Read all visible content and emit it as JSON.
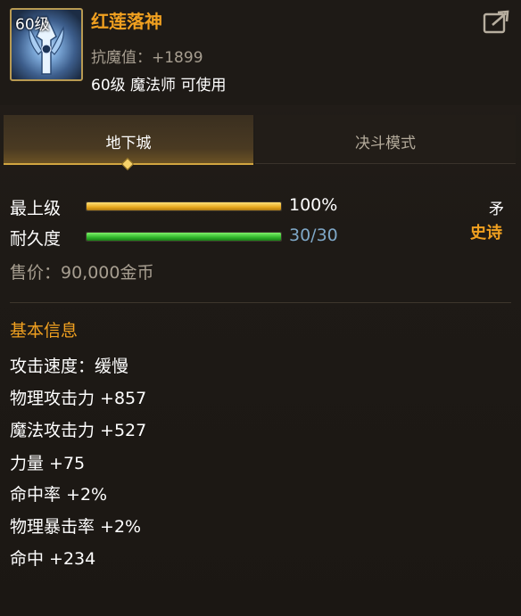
{
  "item": {
    "level_badge": "60级",
    "name": "红莲落神",
    "stat_line": "抗魔值：+1899",
    "requirement": "60级 魔法师 可使用",
    "share_icon": "share-icon"
  },
  "tabs": [
    {
      "label": "地下城",
      "active": true
    },
    {
      "label": "决斗模式",
      "active": false
    }
  ],
  "status": {
    "grade": {
      "label": "最上级",
      "value_text": "100%",
      "value": 1.0
    },
    "durability": {
      "label": "耐久度",
      "value_text": "30/30",
      "value": 1.0
    },
    "weapon_type": "矛",
    "rarity": "史诗",
    "price": "售价：90,000金币"
  },
  "basic_info": {
    "title": "基本信息",
    "attributes": [
      "攻击速度：缓慢",
      "物理攻击力 +857",
      "魔法攻击力 +527",
      "力量 +75",
      "命中率 +2%",
      "物理暴击率 +2%",
      "命中 +234"
    ]
  },
  "colors": {
    "accent_gold": "#f0a020",
    "bar_gold": "#e6a81e",
    "bar_green": "#2fb52a",
    "durability_value": "#7fa8c8",
    "background": "#1c1814"
  }
}
